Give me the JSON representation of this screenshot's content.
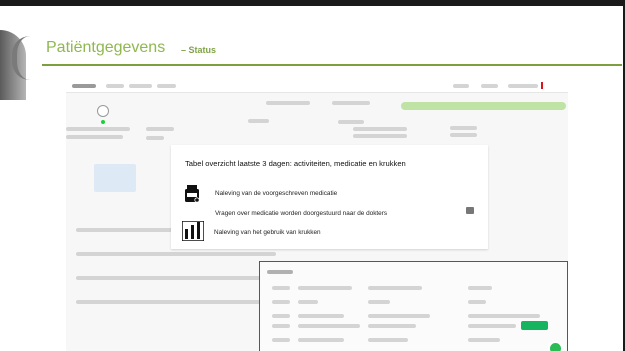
{
  "slide": {
    "title": "Patiëntgegevens",
    "subtitle": "– Status"
  },
  "overlay": {
    "heading": "Tabel overzicht laatste 3 dagen: activiteiten, medicatie en krukken",
    "items": [
      {
        "icon": "medication-icon",
        "text": "Naleving van de voorgeschreven medicatie"
      },
      {
        "icon": "question-icon",
        "text": "Vragen over medicatie worden doorgestuurd naar de dokters"
      },
      {
        "icon": "crutches-icon",
        "text": "Naleving van het gebruik van krukken"
      }
    ]
  },
  "colors": {
    "title_green": "#8fb84f",
    "rule_green": "#7d9f3f",
    "highlight_red": "#d81f26",
    "accent_green": "#17b45f"
  }
}
